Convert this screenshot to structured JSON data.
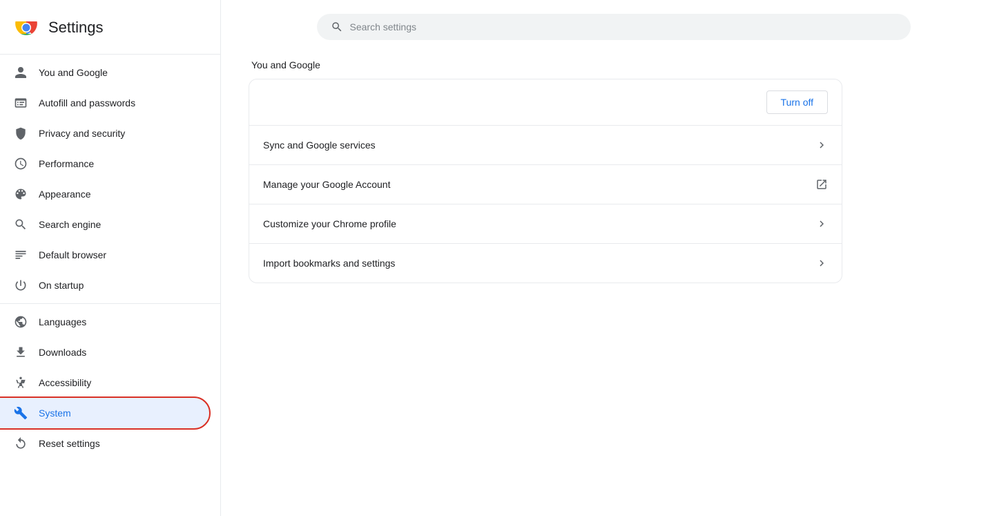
{
  "header": {
    "logo_alt": "Chrome logo",
    "title": "Settings"
  },
  "search": {
    "placeholder": "Search settings"
  },
  "sidebar": {
    "items": [
      {
        "id": "you-and-google",
        "label": "You and Google",
        "icon": "person"
      },
      {
        "id": "autofill-and-passwords",
        "label": "Autofill and passwords",
        "icon": "autofill"
      },
      {
        "id": "privacy-and-security",
        "label": "Privacy and security",
        "icon": "shield"
      },
      {
        "id": "performance",
        "label": "Performance",
        "icon": "performance"
      },
      {
        "id": "appearance",
        "label": "Appearance",
        "icon": "appearance"
      },
      {
        "id": "search-engine",
        "label": "Search engine",
        "icon": "search"
      },
      {
        "id": "default-browser",
        "label": "Default browser",
        "icon": "browser"
      },
      {
        "id": "on-startup",
        "label": "On startup",
        "icon": "startup"
      },
      {
        "id": "languages",
        "label": "Languages",
        "icon": "globe"
      },
      {
        "id": "downloads",
        "label": "Downloads",
        "icon": "download"
      },
      {
        "id": "accessibility",
        "label": "Accessibility",
        "icon": "accessibility"
      },
      {
        "id": "system",
        "label": "System",
        "icon": "system",
        "active": true
      },
      {
        "id": "reset-settings",
        "label": "Reset settings",
        "icon": "reset"
      }
    ]
  },
  "main": {
    "section_title": "You and Google",
    "card": {
      "turn_off_label": "Turn off",
      "rows": [
        {
          "label": "Sync and Google services",
          "icon": "chevron-right"
        },
        {
          "label": "Manage your Google Account",
          "icon": "external-link"
        },
        {
          "label": "Customize your Chrome profile",
          "icon": "chevron-right"
        },
        {
          "label": "Import bookmarks and settings",
          "icon": "chevron-right"
        }
      ]
    }
  }
}
